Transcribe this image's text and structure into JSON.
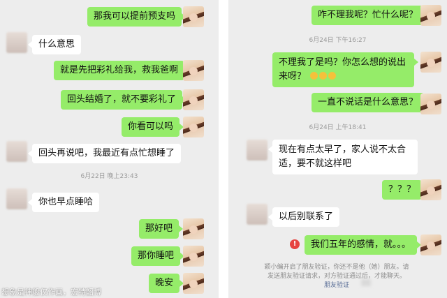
{
  "left_chat": {
    "messages": [
      {
        "from": "me",
        "text": "那我可以提前预支吗"
      },
      {
        "from": "them",
        "text": "什么意思"
      },
      {
        "from": "me",
        "text": "就是先把彩礼给我，救我爸啊"
      },
      {
        "from": "me",
        "text": "回头结婚了，就不要彩礼了"
      },
      {
        "from": "me",
        "text": "你看可以吗"
      },
      {
        "from": "them",
        "text": "回头再说吧，我最近有点忙想睡了"
      },
      {
        "from": "them",
        "text": "你也早点睡哈"
      },
      {
        "from": "me",
        "text": "那好吧"
      },
      {
        "from": "me",
        "text": "那你睡吧"
      },
      {
        "from": "me",
        "text": "晚安"
      }
    ],
    "timestamp": "6月22日 晚上23:43"
  },
  "right_chat": {
    "messages": [
      {
        "from": "me",
        "text": "咋不理我呢？忙什么呢？"
      },
      {
        "from": "me",
        "text": "不理我了是吗？你怎么想的说出来呀？"
      },
      {
        "from": "me",
        "text": "一直不说话是什么意思？"
      },
      {
        "from": "them",
        "text": "现在有点太早了，家人说不太合适，要不就这样吧"
      },
      {
        "from": "me",
        "text": "？？？"
      },
      {
        "from": "them",
        "text": "以后别联系了"
      },
      {
        "from": "me",
        "text": "我们五年的感情，就。。。"
      }
    ],
    "timestamps": [
      "6月24日 下午16:27",
      "6月24日 上午18:41"
    ],
    "notice": {
      "line1": "颖小编开启了朋友验证，你还不是他（她）朋友。请",
      "line2": "发送朋友验证请求，对方验证通过后，才能聊天。",
      "link": "朋友验证"
    }
  },
  "watermark": "想象是神般仅作画，宏特韶博",
  "emoji_icon": "crying-face-emoji",
  "colors": {
    "me_bubble": "#95ec69",
    "them_bubble": "#ffffff",
    "background": "#ededed",
    "link": "#576b95",
    "warning": "#e64340"
  }
}
